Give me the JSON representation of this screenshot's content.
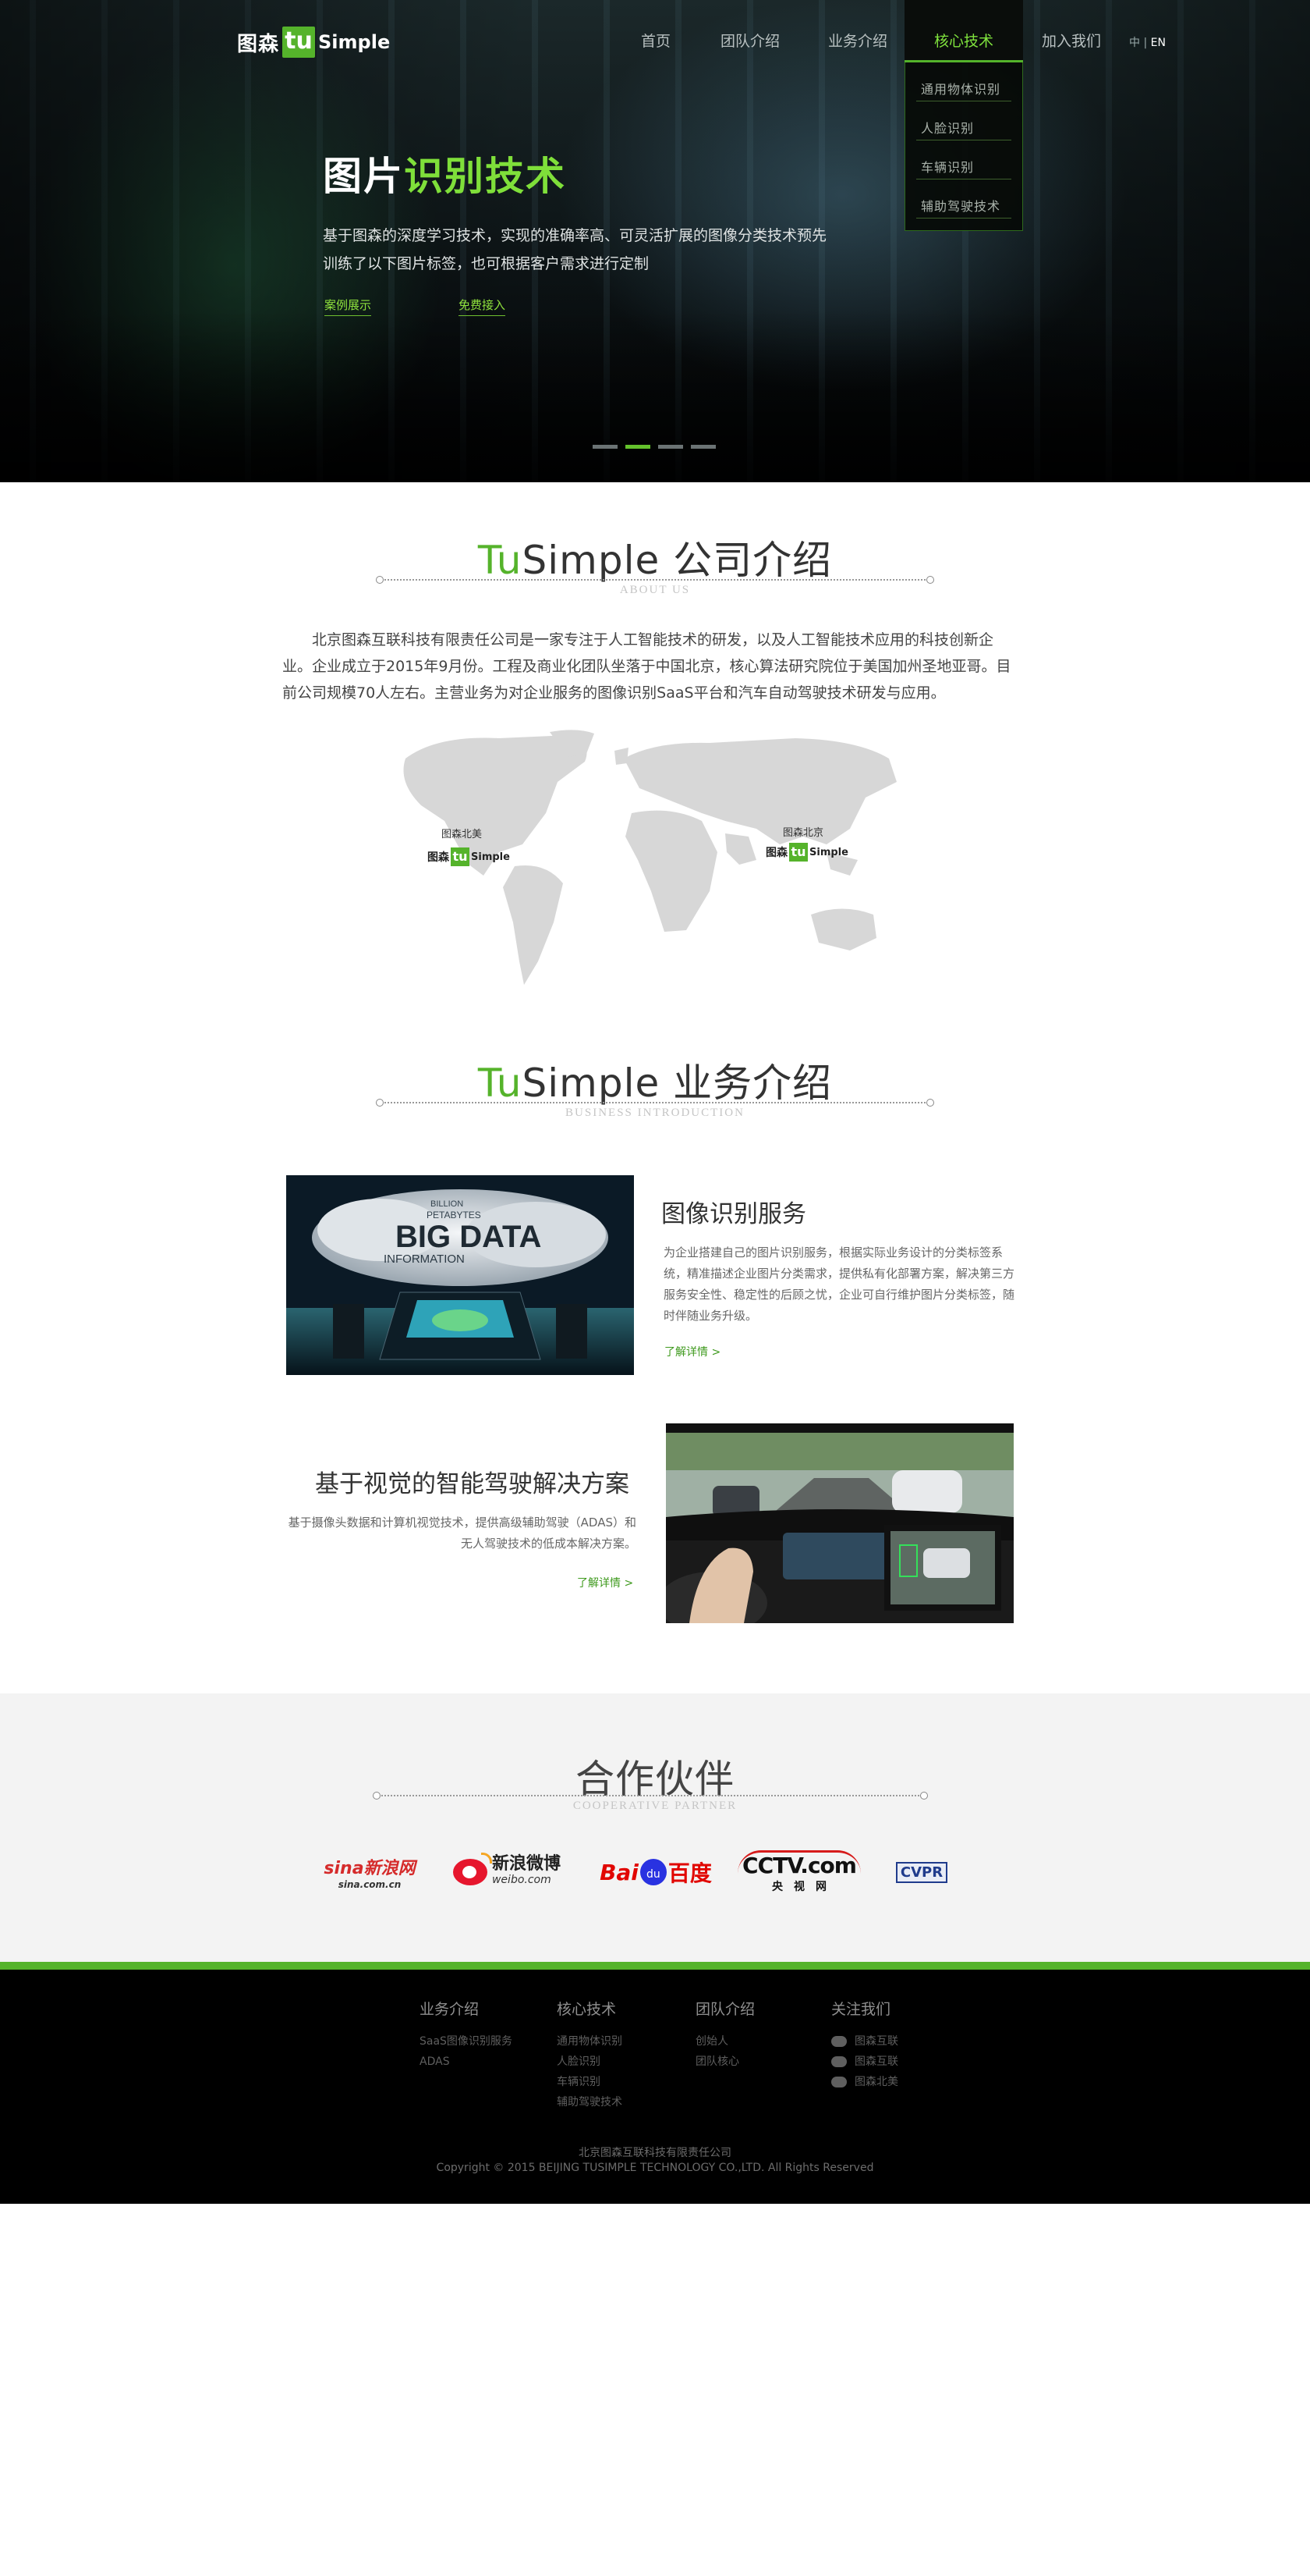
{
  "brand": {
    "cn": "图森",
    "mark": "tu",
    "en": "Simple"
  },
  "nav": {
    "items": [
      "首页",
      "团队介绍",
      "业务介绍",
      "核心技术",
      "加入我们"
    ],
    "active": "核心技术",
    "dropdown": [
      "通用物体识别",
      "人脸识别",
      "车辆识别",
      "辅助驾驶技术"
    ],
    "lang_cn": "中",
    "lang_sep": "|",
    "lang_en": "EN"
  },
  "hero": {
    "title_white": "图片",
    "title_green": "识别技术",
    "desc": "基于图森的深度学习技术，实现的准确率高、可灵活扩展的图像分类技术预先训练了以下图片标签，也可根据客户需求进行定制",
    "link1": "案例展示",
    "link2": "免费接入",
    "slides": 4,
    "active_slide": 2
  },
  "about": {
    "title_green": "Tu",
    "title_rest": "Simple 公司介绍",
    "subtitle": "ABOUT US",
    "text": "北京图森互联科技有限责任公司是一家专注于人工智能技术的研发，以及人工智能技术应用的科技创新企业。企业成立于2015年9月份。工程及商业化团队坐落于中国北京，核心算法研究院位于美国加州圣地亚哥。目前公司规模70人左右。主营业务为对企业服务的图像识别SaaS平台和汽车自动驾驶技术研发与应用。",
    "map_na_label": "图森北美",
    "map_bj_label": "图森北京"
  },
  "business": {
    "title_green": "Tu",
    "title_rest": "Simple 业务介绍",
    "subtitle": "BUSINESS INTRODUCTION",
    "item1": {
      "title": "图像识别服务",
      "desc": "为企业搭建自己的图片识别服务，根据实际业务设计的分类标签系统，精准描述企业图片分类需求，提供私有化部署方案，解决第三方服务安全性、稳定性的后顾之忧，企业可自行维护图片分类标签，随时伴随业务升级。",
      "more": "了解详情 >",
      "img_text_big": "BIG DATA",
      "img_text_info": "INFORMATION",
      "img_text_billion": "BILLION",
      "img_text_peta": "PETABYTES"
    },
    "item2": {
      "title": "基于视觉的智能驾驶解决方案",
      "desc": "基于摄像头数据和计算机视觉技术，提供高级辅助驾驶（ADAS）和无人驾驶技术的低成本解决方案。",
      "more": "了解详情 >"
    }
  },
  "partners": {
    "title": "合作伙伴",
    "subtitle": "COOPERATIVE PARTNER",
    "sina_main": "sina新浪网",
    "sina_sub": "sina.com.cn",
    "weibo_main": "新浪微博",
    "weibo_sub": "weibo.com",
    "baidu_a": "Bai",
    "baidu_b": "du",
    "baidu_c": "百度",
    "cctv_main": "CCTV.com",
    "cctv_sub": "央　视　网",
    "cvpr": "CVPR"
  },
  "footer": {
    "col1": {
      "title": "业务介绍",
      "items": [
        "SaaS图像识别服务",
        "ADAS"
      ]
    },
    "col2": {
      "title": "核心技术",
      "items": [
        "通用物体识别",
        "人脸识别",
        "车辆识别",
        "辅助驾驶技术"
      ]
    },
    "col3": {
      "title": "团队介绍",
      "items": [
        "创始人",
        "团队核心"
      ]
    },
    "col4": {
      "title": "关注我们",
      "items": [
        "图森互联",
        "图森互联",
        "图森北美"
      ]
    },
    "company": "北京图森互联科技有限责任公司",
    "copyright": "Copyright © 2015 BEIJING TUSIMPLE TECHNOLOGY CO.,LTD. All Rights Reserved"
  },
  "colors": {
    "accent": "#55b32b",
    "accent_light": "#7fdf3a",
    "footer_bg": "#000000",
    "partner_bg": "#f3f3f3"
  }
}
